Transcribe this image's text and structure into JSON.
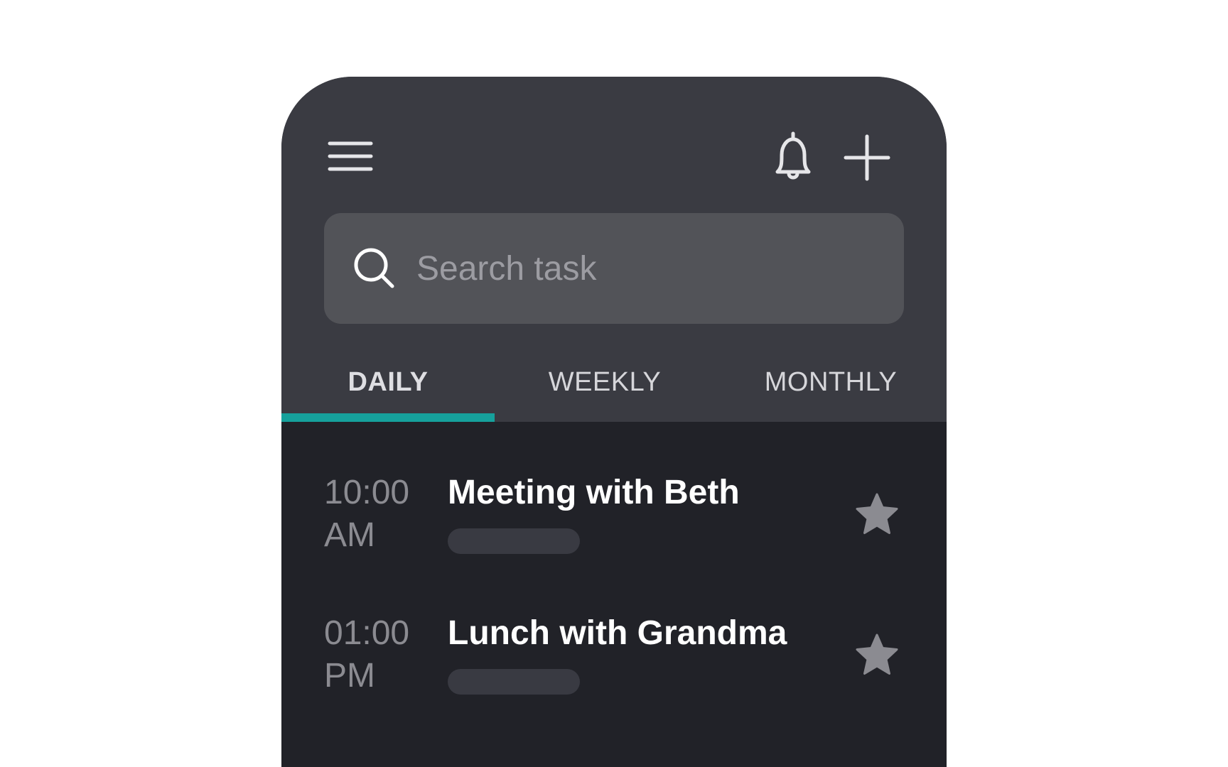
{
  "header": {
    "menu_icon": "hamburger-menu-icon",
    "notifications_icon": "bell-icon",
    "add_icon": "plus-icon"
  },
  "search": {
    "placeholder": "Search task",
    "value": "",
    "icon": "search-icon"
  },
  "tabs": [
    {
      "label": "DAILY",
      "active": true
    },
    {
      "label": "WEEKLY",
      "active": false
    },
    {
      "label": "MONTHLY",
      "active": false
    }
  ],
  "tasks": [
    {
      "time": "10:00",
      "period": "AM",
      "title": "Meeting with Beth",
      "starred": false
    },
    {
      "time": "01:00",
      "period": "PM",
      "title": "Lunch with Grandma",
      "starred": false
    }
  ],
  "colors": {
    "header_bg": "#3a3b42",
    "content_bg": "#212228",
    "search_bg": "#525358",
    "accent": "#16a19c",
    "star": "#8b8b91"
  }
}
